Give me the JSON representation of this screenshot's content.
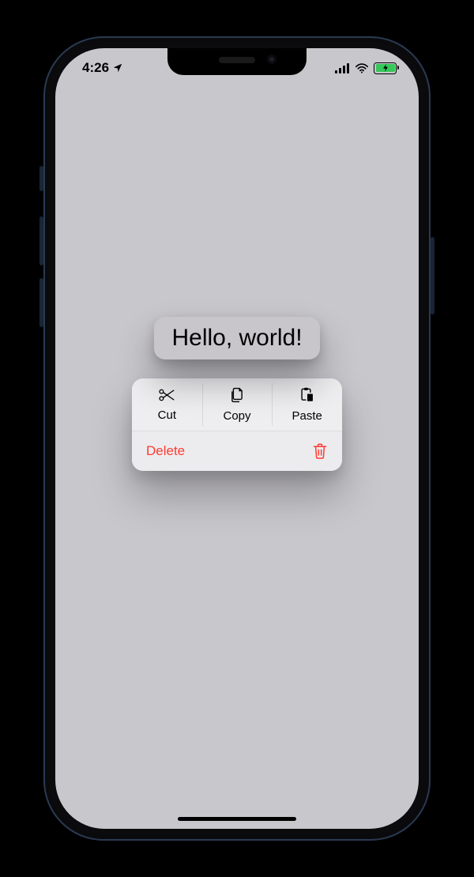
{
  "statusbar": {
    "time": "4:26",
    "location_icon": "location-arrow-icon",
    "signal_icon": "cellular-icon",
    "wifi_icon": "wifi-icon",
    "battery_icon": "battery-charging-icon"
  },
  "preview": {
    "text": "Hello, world!"
  },
  "menu": {
    "top": [
      {
        "label": "Cut",
        "icon": "scissors-icon"
      },
      {
        "label": "Copy",
        "icon": "doc-on-doc-icon"
      },
      {
        "label": "Paste",
        "icon": "clipboard-icon"
      }
    ],
    "delete": {
      "label": "Delete",
      "icon": "trash-icon",
      "color": "#ff3b30"
    }
  }
}
